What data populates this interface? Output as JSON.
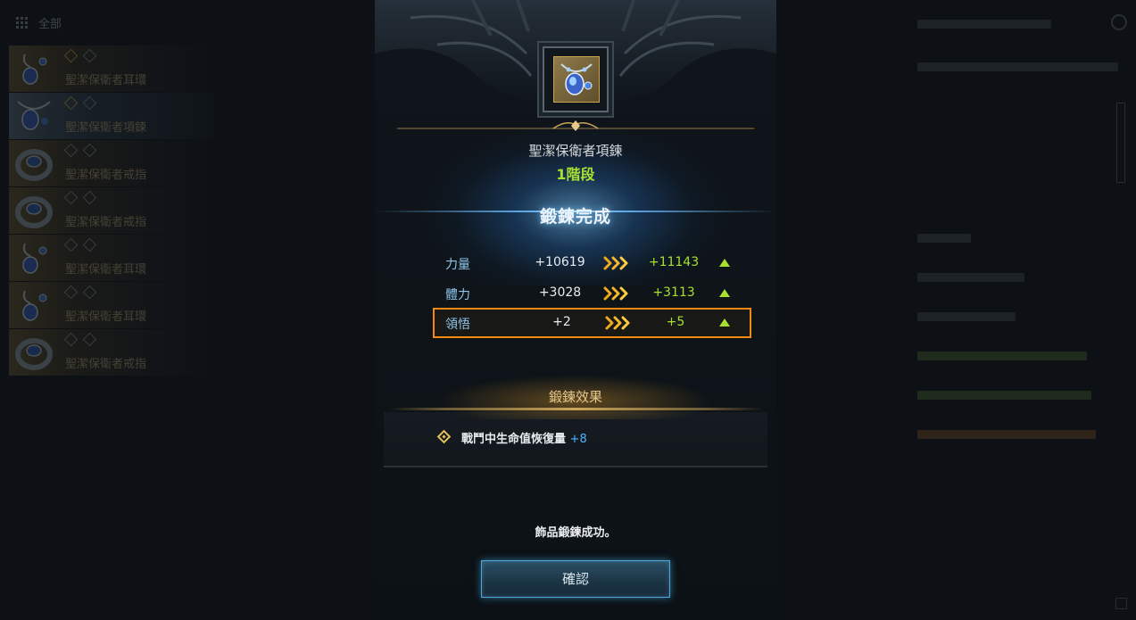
{
  "filter": {
    "label": "全部",
    "icon": "grid-icon"
  },
  "item_list": [
    {
      "name": "聖潔保衛者耳環",
      "type": "earring",
      "selected": false,
      "gems": [
        "gold",
        "grey"
      ]
    },
    {
      "name": "聖潔保衛者項鍊",
      "type": "necklace",
      "selected": true,
      "gems": [
        "gold",
        "grey"
      ]
    },
    {
      "name": "聖潔保衛者戒指",
      "type": "ring",
      "selected": false,
      "gems": [
        "grey",
        "grey"
      ]
    },
    {
      "name": "聖潔保衛者戒指",
      "type": "ring",
      "selected": false,
      "gems": [
        "grey",
        "grey"
      ]
    },
    {
      "name": "聖潔保衛者耳環",
      "type": "earring",
      "selected": false,
      "gems": [
        "grey",
        "grey"
      ]
    },
    {
      "name": "聖潔保衛者耳環",
      "type": "earring",
      "selected": false,
      "gems": [
        "grey",
        "grey"
      ]
    },
    {
      "name": "聖潔保衛者戒指",
      "type": "ring",
      "selected": false,
      "gems": [
        "grey",
        "grey"
      ]
    }
  ],
  "modal": {
    "item_name": "聖潔保衛者項鍊",
    "stage": "1階段",
    "result_title": "鍛鍊完成",
    "stats": [
      {
        "name": "力量",
        "old": "+10619",
        "new": "+11143",
        "highlight": false
      },
      {
        "name": "體力",
        "old": "+3028",
        "new": "+3113",
        "highlight": false
      },
      {
        "name": "領悟",
        "old": "+2",
        "new": "+5",
        "highlight": true
      }
    ],
    "effect_title": "鍛鍊效果",
    "effect": {
      "label": "戰鬥中生命值恢復量",
      "value": "+8"
    },
    "success_message": "飾品鍛鍊成功。",
    "confirm_label": "確認"
  },
  "colors": {
    "stat_up": "#a8e032",
    "stat_name": "#8fc4e8",
    "highlight_border": "#f08a10",
    "effect_value": "#48b6ff",
    "accent_gold": "#e6c98a",
    "button_border": "#4fa8d8"
  }
}
